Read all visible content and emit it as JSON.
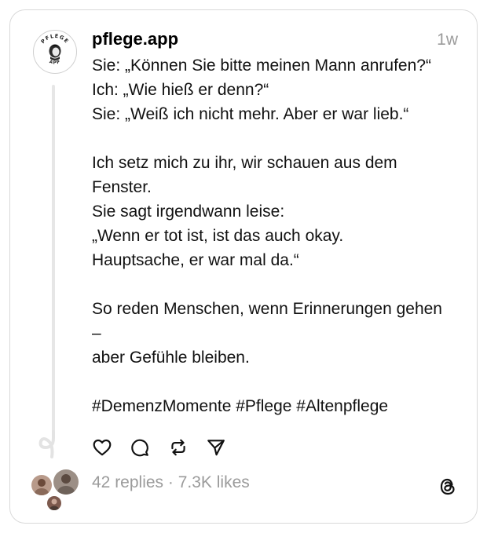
{
  "post": {
    "username": "pflege.app",
    "time": "1w",
    "avatar_text_top": "PFLEGE",
    "avatar_text_bottom": "APP",
    "body_lines": [
      "Sie: „Können Sie bitte meinen Mann anrufen?“",
      "Ich: „Wie hieß er denn?“",
      "Sie: „Weiß ich nicht mehr. Aber er war lieb.“",
      "",
      "Ich setz mich zu ihr, wir schauen aus dem",
      "Fenster.",
      "Sie sagt irgendwann leise:",
      "„Wenn er tot ist, ist das auch okay.",
      "Hauptsache, er war mal da.“",
      "",
      "So reden Menschen, wenn Erinnerungen gehen",
      "–",
      "aber Gefühle bleiben.",
      "",
      "#DemenzMomente #Pflege #Altenpflege"
    ]
  },
  "actions": {
    "like_icon": "heart-icon",
    "reply_icon": "comment-icon",
    "repost_icon": "repost-icon",
    "share_icon": "send-icon"
  },
  "stats": {
    "text": "42 replies · 7.3K likes"
  },
  "branding": {
    "logo_icon": "threads-logo-icon"
  },
  "colors": {
    "text": "#111111",
    "muted": "#9b9b9b",
    "border": "#d9d9d9",
    "thread_line": "#e6e6e6"
  }
}
